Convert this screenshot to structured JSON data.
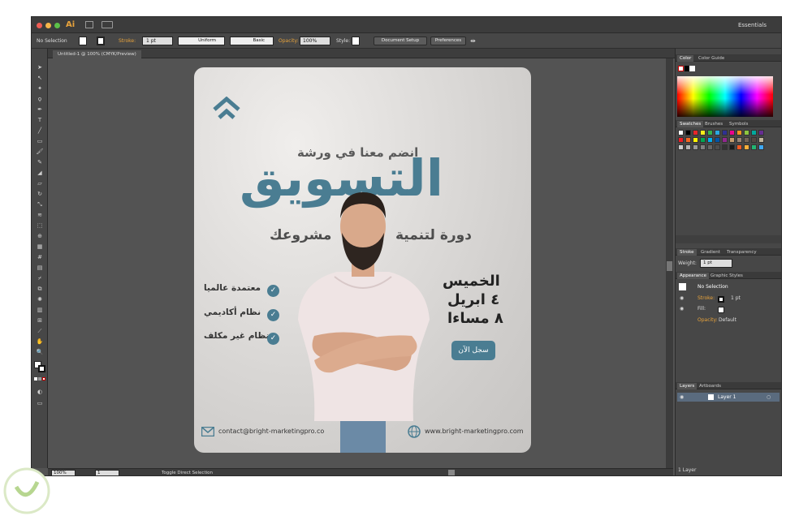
{
  "app": {
    "logo": "Ai",
    "workspace": "Essentials"
  },
  "control_bar": {
    "selection": "No Selection",
    "stroke_label": "Stroke:",
    "stroke_weight": "1 pt",
    "profile": "Uniform",
    "brush": "Basic",
    "opacity_label": "Opacity:",
    "opacity_value": "100%",
    "style_label": "Style:",
    "document_setup": "Document Setup",
    "preferences": "Preferences"
  },
  "document": {
    "tab_title": "Untitled-1 @ 100% (CMYK/Preview)"
  },
  "status_bar": {
    "zoom": "100%",
    "artboard_num": "1",
    "tool_hint": "Toggle Direct Selection"
  },
  "panels": {
    "color_tabs": [
      "Color",
      "Color Guide"
    ],
    "swatch_tabs": [
      "Swatches",
      "Brushes",
      "Symbols"
    ],
    "stroke_tabs": [
      "Stroke",
      "Gradient",
      "Transparency"
    ],
    "weight_label": "Weight:",
    "weight_value": "1 pt",
    "appearance_tabs": [
      "Appearance",
      "Graphic Styles"
    ],
    "appearance": {
      "title": "No Selection",
      "stroke_label": "Stroke:",
      "stroke_value": "1 pt",
      "fill_label": "Fill:",
      "opacity_label": "Opacity:",
      "opacity_value": "Default"
    },
    "layers_tabs": [
      "Layers",
      "Artboards"
    ],
    "layer_name": "Layer 1",
    "layers_count": "1 Layer"
  },
  "artwork": {
    "line1": "انضم معنا في ورشة",
    "headline": "التسويق",
    "line3a": "دورة لتنمية",
    "line3b": "مشروعك",
    "features": [
      "معتمدة عالميا",
      "نظام أكاديمي",
      "نظام غير مكلف"
    ],
    "day": "الخميس",
    "date": "٤ ابريل",
    "time": "٨ مساءا",
    "cta": "سجل الآن",
    "email": "contact@bright-marketingpro.co",
    "website": "www.bright-marketingpro.com"
  },
  "colors": {
    "accent": "#4a7d92",
    "ai_orange": "#e8a33b",
    "ui_dark": "#535353"
  }
}
